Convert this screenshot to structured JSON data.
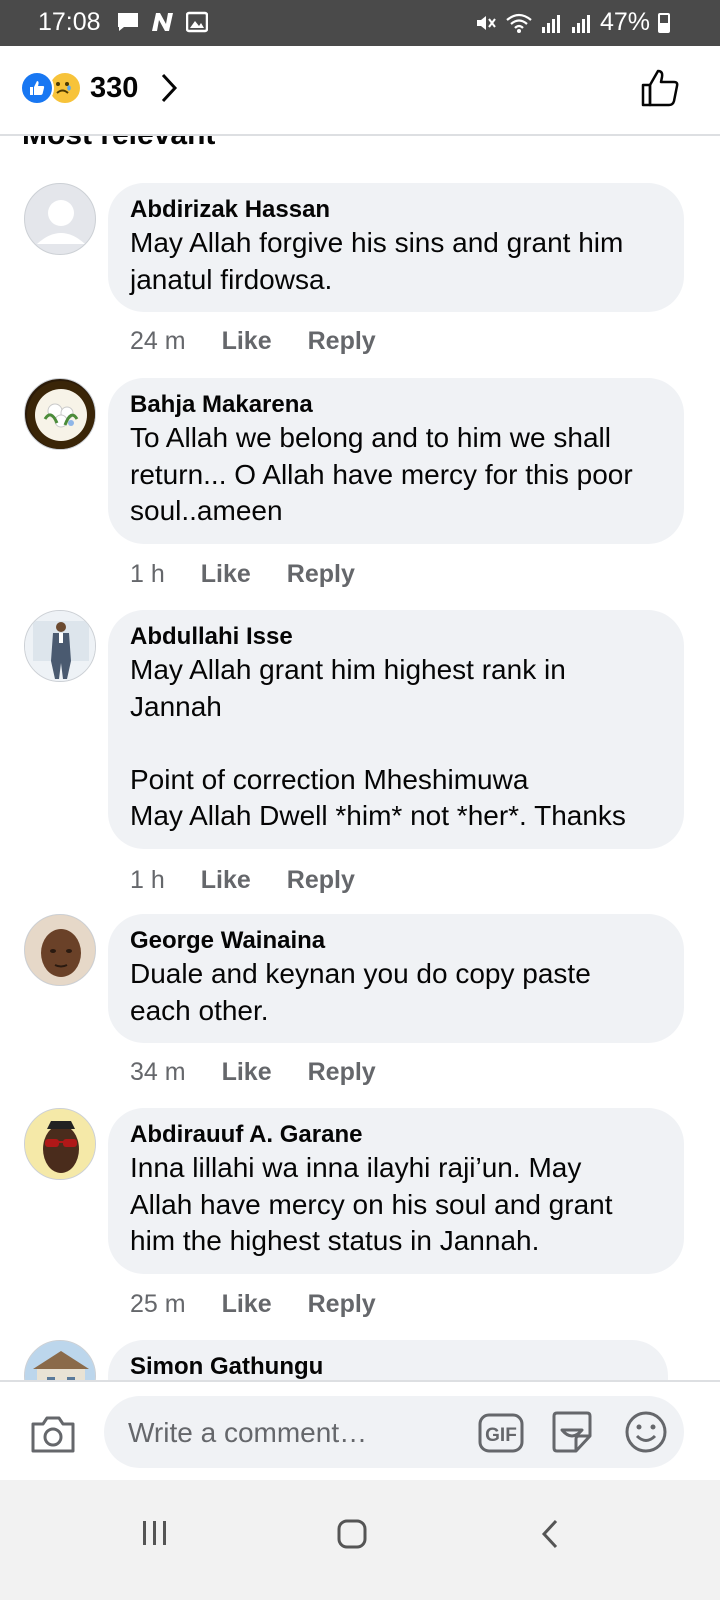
{
  "status_bar": {
    "time": "17:08",
    "battery": "47%",
    "left_icons": [
      "chat-notification-icon",
      "n-app-icon",
      "gallery-icon"
    ],
    "right_icons": [
      "mute-icon",
      "wifi-icon",
      "signal-icon",
      "signal-icon-2",
      "battery-icon"
    ]
  },
  "header": {
    "reaction_icons": [
      "like-reaction-icon",
      "sad-reaction-icon"
    ],
    "reaction_count": "330",
    "sort_label_partial": "Most relevant"
  },
  "comments": [
    {
      "name": "Abdirizak Hassan",
      "text": "May Allah forgive his sins and  grant him\njanatul firdowsa.",
      "time": "24 m",
      "like": "Like",
      "reply": "Reply",
      "avatar": "default-avatar"
    },
    {
      "name": "Bahja Makarena",
      "text": "To Allah we belong and to him we shall\nreturn... O Allah have mercy for this poor\nsoul..ameen",
      "time": "1 h",
      "like": "Like",
      "reply": "Reply",
      "avatar": "flowers-avatar"
    },
    {
      "name": "Abdullahi Isse",
      "text": "May Allah grant him highest rank in\nJannah\n\nPoint of correction Mheshimuwa\nMay Allah Dwell *him* not *her*. Thanks",
      "time": "1 h",
      "like": "Like",
      "reply": "Reply",
      "avatar": "man-in-suit-avatar"
    },
    {
      "name": "George Wainaina",
      "text": "Duale and keynan you do copy paste\neach other.",
      "time": "34 m",
      "like": "Like",
      "reply": "Reply",
      "avatar": "face-avatar"
    },
    {
      "name": "Abdirauuf A. Garane",
      "text": "Inna lillahi wa inna ilayhi raji’un. May\nAllah have mercy on his soul and grant\nhim the highest status in Jannah.",
      "time": "25 m",
      "like": "Like",
      "reply": "Reply",
      "avatar": "sunglasses-avatar"
    },
    {
      "name": "Simon Gathungu",
      "text": "",
      "time": "",
      "like": "",
      "reply": "",
      "avatar": "building-avatar"
    }
  ],
  "composer": {
    "placeholder": "Write a comment…",
    "gif_label": "GIF"
  },
  "colors": {
    "bubble": "#f0f2f5",
    "facebook_blue": "#1877f2",
    "secondary_text": "#65676b",
    "status_bar": "#4a4a4a"
  }
}
